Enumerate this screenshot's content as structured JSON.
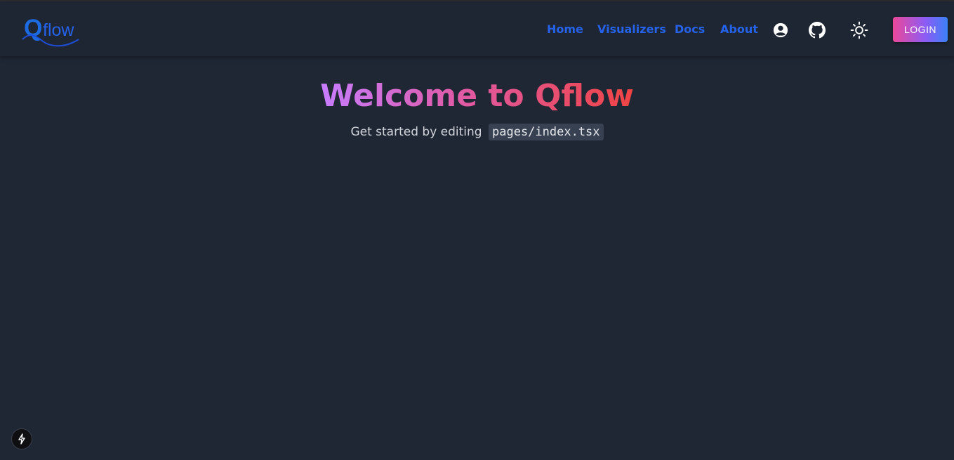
{
  "colors": {
    "background": "#1f2735",
    "navbar": "#1f2633",
    "nav_link": "#2563eb",
    "title_gradient_start": "#c77dff",
    "title_gradient_end": "#ef4444",
    "login_gradient_start": "#ec4899",
    "login_gradient_end": "#3b82f6"
  },
  "header": {
    "logo": {
      "q": "Q",
      "rest": "flow"
    },
    "nav": [
      {
        "label": "Home"
      },
      {
        "label": "Visualizers"
      },
      {
        "label": "Docs"
      },
      {
        "label": "About"
      }
    ],
    "icons": {
      "account": "account-circle-icon",
      "github": "github-icon",
      "theme": "sun-icon"
    },
    "login_label": "LOGIN"
  },
  "main": {
    "title": "Welcome to Qflow",
    "subtitle_text": "Get started by editing",
    "subtitle_code": "pages/index.tsx"
  },
  "footer": {
    "bolt_icon": "lightning-bolt-icon"
  }
}
